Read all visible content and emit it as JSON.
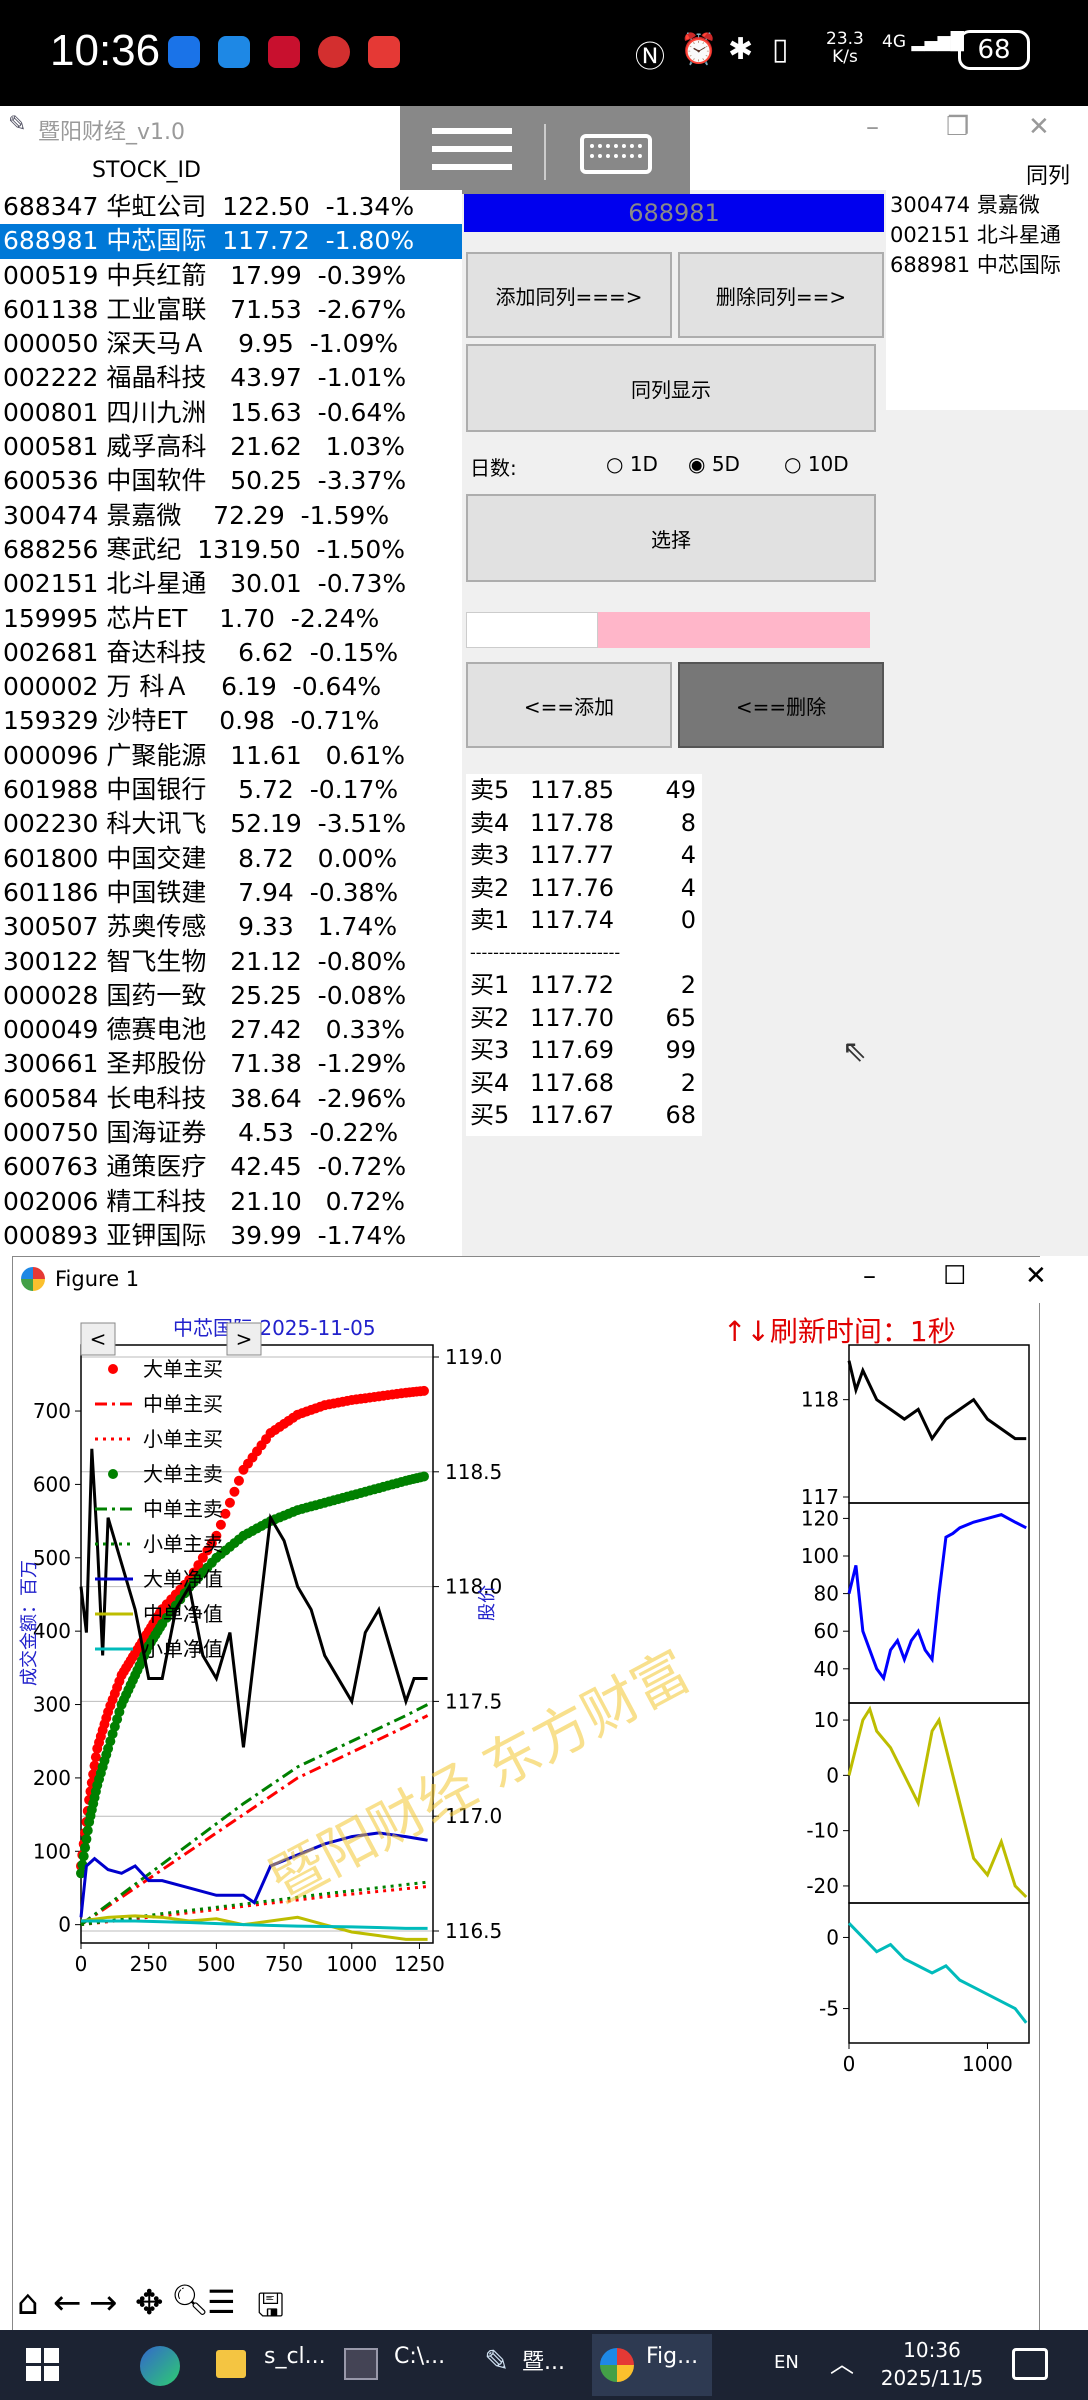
{
  "status_bar": {
    "time": "10:36",
    "net_speed": "23.3",
    "net_unit": "K/s",
    "signal": "4G",
    "battery": "68"
  },
  "app": {
    "title": "暨阳财经_v1.0",
    "col_stock_id": "STOCK_ID",
    "col_peer": "同列列",
    "selected_code_display": "688981",
    "buttons": {
      "add_peer": "添加同列===>",
      "del_peer": "删除同列==>",
      "show_peer": "同列显示",
      "select": "选择",
      "add": "<==添加",
      "del": "<==删除"
    },
    "days_label": "日数:",
    "day_options": [
      "1D",
      "5D",
      "10D"
    ],
    "selected_day": "5D"
  },
  "stocks": [
    "688347 华虹公司  122.50  -1.34%",
    "688981 中芯国际  117.72  -1.80%",
    "000519 中兵红箭   17.99  -0.39%",
    "601138 工业富联   71.53  -2.67%",
    "000050 深天马Ａ    9.95  -1.09%",
    "002222 福晶科技   43.97  -1.01%",
    "000801 四川九洲   15.63  -0.64%",
    "000581 威孚高科   21.62   1.03%",
    "600536 中国软件   50.25  -3.37%",
    "300474 景嘉微    72.29  -1.59%",
    "688256 寒武纪  1319.50  -1.50%",
    "002151 北斗星通   30.01  -0.73%",
    "159995 芯片ET    1.70  -2.24%",
    "002681 奋达科技    6.62  -0.15%",
    "000002 万 科Ａ    6.19  -0.64%",
    "159329 沙特ET    0.98  -0.71%",
    "000096 广聚能源   11.61   0.61%",
    "601988 中国银行    5.72  -0.17%",
    "002230 科大讯飞   52.19  -3.51%",
    "601800 中国交建    8.72   0.00%",
    "601186 中国铁建    7.94  -0.38%",
    "300507 苏奥传感    9.33   1.74%",
    "300122 智飞生物   21.12  -0.80%",
    "000028 国药一致   25.25  -0.08%",
    "000049 德赛电池   27.42   0.33%",
    "300661 圣邦股份   71.38  -1.29%",
    "600584 长电科技   38.64  -2.96%",
    "000750 国海证券    4.53  -0.22%",
    "600763 通策医疗   42.45  -0.72%",
    "002006 精工科技   21.10   0.72%",
    "000893 亚钾国际   39.99  -1.74%"
  ],
  "selected_stock_index": 1,
  "peers": [
    "300474 景嘉微",
    "002151 北斗星通",
    "688981 中芯国际"
  ],
  "order_book": {
    "asks": [
      {
        "label": "卖5",
        "price": "117.85",
        "vol": "49"
      },
      {
        "label": "卖4",
        "price": "117.78",
        "vol": "8"
      },
      {
        "label": "卖3",
        "price": "117.77",
        "vol": "4"
      },
      {
        "label": "卖2",
        "price": "117.76",
        "vol": "4"
      },
      {
        "label": "卖1",
        "price": "117.74",
        "vol": "0"
      }
    ],
    "divider": "--------------------------",
    "bids": [
      {
        "label": "买1",
        "price": "117.72",
        "vol": "2"
      },
      {
        "label": "买2",
        "price": "117.70",
        "vol": "65"
      },
      {
        "label": "买3",
        "price": "117.69",
        "vol": "99"
      },
      {
        "label": "买4",
        "price": "117.68",
        "vol": "2"
      },
      {
        "label": "买5",
        "price": "117.67",
        "vol": "68"
      }
    ]
  },
  "figure": {
    "window_title": "Figure 1",
    "chart_title": "中芯国际  2025-11-05",
    "refresh_text": "↑↓刷新时间：1秒",
    "watermark": "暨阳财经  东方财富",
    "nav_prev": "<",
    "nav_next": ">"
  },
  "chart_data": [
    {
      "type": "line",
      "ylabel": "成交金额：百万",
      "ylabel_right": "股价",
      "xlim": [
        0,
        1300
      ],
      "ylim": [
        -25,
        790
      ],
      "ylim_right": [
        116.5,
        119.0
      ],
      "xticks": [
        0,
        250,
        500,
        750,
        1000,
        1250
      ],
      "yticks": [
        0,
        100,
        200,
        300,
        400,
        500,
        600,
        700
      ],
      "yticks_right": [
        "116.5",
        "117.0",
        "117.5",
        "118.0",
        "118.5",
        "119.0"
      ],
      "legend": [
        "大单主买",
        "中单主买",
        "小单主买",
        "大单主卖",
        "中单主卖",
        "小单主卖",
        "大单净值",
        "中单净值",
        "小单净值"
      ],
      "legend_position": "upper-left",
      "series": [
        {
          "name": "大单主买",
          "color": "#ff0000",
          "style": "dots",
          "x": [
            0,
            30,
            60,
            100,
            150,
            200,
            250,
            300,
            400,
            500,
            600,
            700,
            800,
            900,
            1000,
            1100,
            1200,
            1280
          ],
          "y": [
            80,
            170,
            240,
            290,
            340,
            370,
            400,
            430,
            470,
            530,
            620,
            670,
            695,
            708,
            715,
            720,
            725,
            728
          ]
        },
        {
          "name": "中单主买",
          "color": "#ff0000",
          "style": "dashdot",
          "x": [
            0,
            200,
            400,
            600,
            800,
            1000,
            1200,
            1280
          ],
          "y": [
            0,
            50,
            100,
            150,
            200,
            235,
            270,
            285
          ]
        },
        {
          "name": "小单主买",
          "color": "#ff0000",
          "style": "dotted",
          "x": [
            0,
            300,
            600,
            900,
            1280
          ],
          "y": [
            0,
            12,
            25,
            38,
            52
          ]
        },
        {
          "name": "大单主卖",
          "color": "#008000",
          "style": "dots",
          "x": [
            0,
            30,
            60,
            100,
            150,
            200,
            250,
            300,
            400,
            500,
            600,
            700,
            800,
            900,
            1000,
            1100,
            1200,
            1280
          ],
          "y": [
            70,
            140,
            190,
            240,
            300,
            340,
            380,
            410,
            460,
            500,
            530,
            550,
            565,
            575,
            585,
            595,
            605,
            612
          ]
        },
        {
          "name": "中单主卖",
          "color": "#008000",
          "style": "dashdot",
          "x": [
            0,
            200,
            400,
            600,
            800,
            1000,
            1200,
            1280
          ],
          "y": [
            0,
            55,
            110,
            165,
            215,
            250,
            285,
            300
          ]
        },
        {
          "name": "小单主卖",
          "color": "#008000",
          "style": "dotted",
          "x": [
            0,
            300,
            600,
            900,
            1280
          ],
          "y": [
            0,
            15,
            28,
            42,
            58
          ]
        },
        {
          "name": "大单净值",
          "color": "#0000cc",
          "style": "line",
          "x": [
            0,
            20,
            50,
            100,
            150,
            200,
            250,
            300,
            400,
            500,
            600,
            640,
            700,
            800,
            900,
            1000,
            1100,
            1200,
            1280
          ],
          "y": [
            10,
            80,
            90,
            75,
            70,
            80,
            60,
            60,
            50,
            40,
            40,
            30,
            80,
            95,
            110,
            120,
            125,
            120,
            115
          ]
        },
        {
          "name": "中单净值",
          "color": "#bdbd00",
          "style": "line",
          "x": [
            0,
            100,
            200,
            300,
            400,
            500,
            600,
            700,
            800,
            900,
            1000,
            1100,
            1200,
            1280
          ],
          "y": [
            5,
            10,
            12,
            10,
            5,
            8,
            0,
            5,
            10,
            0,
            -10,
            -15,
            -20,
            -20
          ]
        },
        {
          "name": "小单净值",
          "color": "#00bbbb",
          "style": "line",
          "x": [
            0,
            200,
            400,
            600,
            800,
            1000,
            1200,
            1280
          ],
          "y": [
            5,
            5,
            3,
            0,
            -2,
            -3,
            -5,
            -5
          ]
        },
        {
          "name": "股价",
          "color": "#000000",
          "style": "line",
          "axis": "right",
          "x": [
            0,
            20,
            40,
            60,
            80,
            100,
            150,
            200,
            250,
            300,
            350,
            400,
            450,
            500,
            550,
            600,
            650,
            700,
            750,
            800,
            850,
            900,
            950,
            1000,
            1050,
            1100,
            1150,
            1200,
            1230,
            1260,
            1280
          ],
          "y": [
            118.0,
            117.8,
            118.6,
            118.2,
            117.7,
            118.3,
            118.1,
            117.9,
            117.6,
            117.6,
            117.9,
            118.0,
            117.7,
            117.6,
            117.8,
            117.3,
            117.8,
            118.3,
            118.2,
            118.0,
            117.9,
            117.7,
            117.6,
            117.5,
            117.8,
            117.9,
            117.7,
            117.5,
            117.6,
            117.6,
            117.6
          ]
        }
      ]
    },
    {
      "type": "line",
      "ylim": [
        117,
        118.5
      ],
      "yticks": [
        "117",
        "118"
      ],
      "series": [
        {
          "color": "#000000",
          "x": [
            0,
            50,
            100,
            200,
            300,
            400,
            500,
            600,
            700,
            800,
            900,
            1000,
            1100,
            1200,
            1280
          ],
          "y": [
            118.4,
            118.1,
            118.3,
            118.0,
            117.9,
            117.8,
            117.9,
            117.6,
            117.8,
            117.9,
            118.0,
            117.8,
            117.7,
            117.6,
            117.6
          ]
        }
      ]
    },
    {
      "type": "line",
      "ylim": [
        25,
        125
      ],
      "yticks": [
        "40",
        "60",
        "80",
        "100",
        "120"
      ],
      "series": [
        {
          "color": "#0000ff",
          "x": [
            0,
            50,
            100,
            150,
            200,
            250,
            300,
            350,
            400,
            450,
            500,
            550,
            600,
            650,
            700,
            750,
            800,
            900,
            1000,
            1100,
            1200,
            1280
          ],
          "y": [
            80,
            95,
            60,
            50,
            40,
            35,
            50,
            55,
            45,
            55,
            60,
            50,
            45,
            80,
            110,
            112,
            115,
            118,
            120,
            122,
            118,
            115
          ]
        }
      ]
    },
    {
      "type": "line",
      "ylim": [
        -22,
        12
      ],
      "yticks": [
        "-20",
        "-10",
        "0",
        "10"
      ],
      "series": [
        {
          "color": "#bdbd00",
          "x": [
            0,
            50,
            100,
            150,
            200,
            300,
            400,
            500,
            600,
            650,
            700,
            800,
            900,
            1000,
            1100,
            1200,
            1280
          ],
          "y": [
            0,
            5,
            10,
            12,
            8,
            5,
            0,
            -5,
            8,
            10,
            5,
            -5,
            -15,
            -18,
            -12,
            -20,
            -22
          ]
        }
      ]
    },
    {
      "type": "line",
      "ylim": [
        -7,
        2
      ],
      "yticks": [
        "-5",
        "0"
      ],
      "series": [
        {
          "color": "#00bbbb",
          "x": [
            0,
            100,
            200,
            300,
            400,
            500,
            600,
            700,
            800,
            900,
            1000,
            1100,
            1200,
            1280
          ],
          "y": [
            1,
            0,
            -1,
            -0.5,
            -1.5,
            -2,
            -2.5,
            -2,
            -3,
            -3.5,
            -4,
            -4.5,
            -5,
            -6
          ]
        }
      ]
    }
  ],
  "taskbar": {
    "items": [
      "s_cl...",
      "C:\\...",
      "暨...",
      "Fig..."
    ],
    "lang": "EN",
    "time": "10:36",
    "date": "2025/11/5"
  }
}
